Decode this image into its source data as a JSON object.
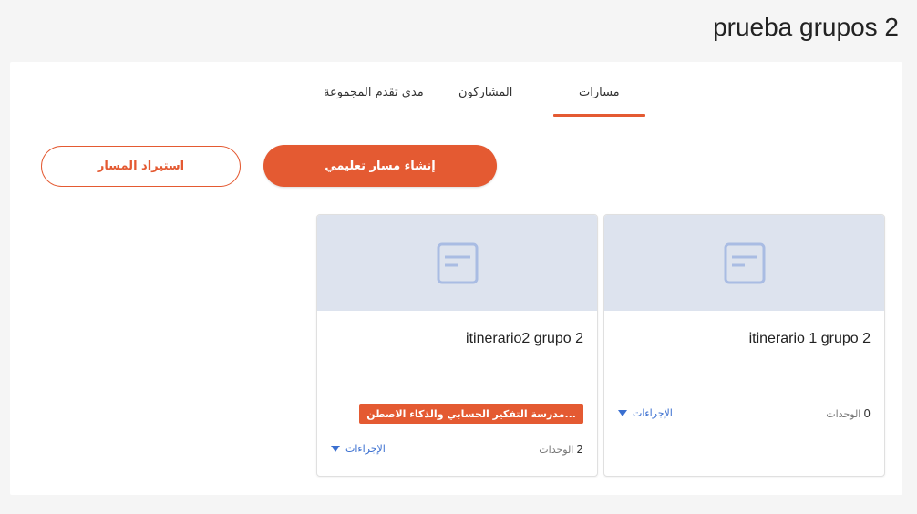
{
  "page": {
    "title": "prueba grupos 2"
  },
  "tabs": [
    {
      "label": "مسارات",
      "active": true
    },
    {
      "label": "المشاركون",
      "active": false
    },
    {
      "label": "مدى تقدم المجموعة",
      "active": false
    }
  ],
  "actions": {
    "create_label": "إنشاء مسار تعليمي",
    "import_label": "استيراد المسار"
  },
  "cards": [
    {
      "title": "itinerario 1 grupo 2",
      "units_count": "0",
      "units_label": "الوحدات",
      "actions_label": "الإجراءات",
      "badge": ""
    },
    {
      "title": "itinerario2 grupo 2",
      "units_count": "2",
      "units_label": "الوحدات",
      "actions_label": "الإجراءات",
      "badge": "مدرسة التفكير الحسابي والذكاء الاصطن..."
    }
  ],
  "colors": {
    "accent": "#e45a32",
    "link": "#3a6fd0",
    "thumb_bg": "#dde3ee"
  },
  "icons": {
    "card_thumb": "document-icon",
    "actions_caret": "caret-down-icon"
  }
}
